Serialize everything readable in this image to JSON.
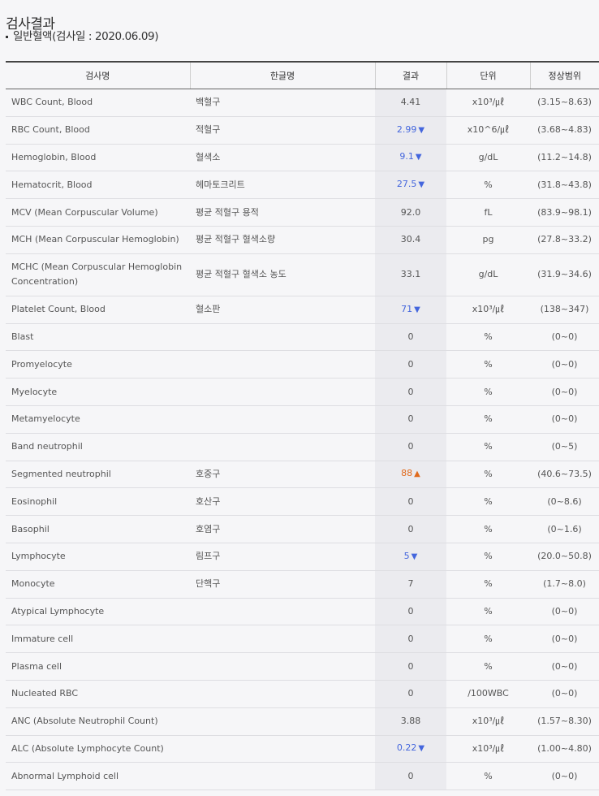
{
  "page_title": "검사결과",
  "subtitle": "일반혈액(검사일 : 2020.06.09)",
  "headers": [
    "검사명",
    "한글명",
    "결과",
    "단위",
    "정상범위"
  ],
  "rows": [
    {
      "name": "WBC Count, Blood",
      "kor": "백혈구",
      "result": "4.41",
      "flag": "",
      "unit": "x10³/㎕",
      "range": "(3.15~8.63)"
    },
    {
      "name": "RBC Count, Blood",
      "kor": "적혈구",
      "result": "2.99",
      "flag": "low",
      "unit": "x10^6/㎕",
      "range": "(3.68~4.83)"
    },
    {
      "name": "Hemoglobin, Blood",
      "kor": "혈색소",
      "result": "9.1",
      "flag": "low",
      "unit": "g/dL",
      "range": "(11.2~14.8)"
    },
    {
      "name": "Hematocrit, Blood",
      "kor": "헤마토크리트",
      "result": "27.5",
      "flag": "low",
      "unit": "%",
      "range": "(31.8~43.8)"
    },
    {
      "name": "MCV (Mean Corpuscular Volume)",
      "kor": "평균 적혈구 용적",
      "result": "92.0",
      "flag": "",
      "unit": "fL",
      "range": "(83.9~98.1)"
    },
    {
      "name": "MCH (Mean Corpuscular Hemoglobin)",
      "kor": "평균 적혈구 혈색소량",
      "result": "30.4",
      "flag": "",
      "unit": "pg",
      "range": "(27.8~33.2)"
    },
    {
      "name": "MCHC (Mean Corpuscular Hemoglobin Concentration)",
      "kor": "평균 적혈구 혈색소 농도",
      "result": "33.1",
      "flag": "",
      "unit": "g/dL",
      "range": "(31.9~34.6)",
      "tall": true
    },
    {
      "name": "Platelet Count, Blood",
      "kor": "혈소판",
      "result": "71",
      "flag": "low",
      "unit": "x10³/㎕",
      "range": "(138~347)"
    },
    {
      "name": "Blast",
      "kor": "",
      "result": "0",
      "flag": "",
      "unit": "%",
      "range": "(0~0)"
    },
    {
      "name": "Promyelocyte",
      "kor": "",
      "result": "0",
      "flag": "",
      "unit": "%",
      "range": "(0~0)"
    },
    {
      "name": "Myelocyte",
      "kor": "",
      "result": "0",
      "flag": "",
      "unit": "%",
      "range": "(0~0)"
    },
    {
      "name": "Metamyelocyte",
      "kor": "",
      "result": "0",
      "flag": "",
      "unit": "%",
      "range": "(0~0)"
    },
    {
      "name": "Band neutrophil",
      "kor": "",
      "result": "0",
      "flag": "",
      "unit": "%",
      "range": "(0~5)"
    },
    {
      "name": "Segmented neutrophil",
      "kor": "호중구",
      "result": "88",
      "flag": "high",
      "unit": "%",
      "range": "(40.6~73.5)"
    },
    {
      "name": "Eosinophil",
      "kor": "호산구",
      "result": "0",
      "flag": "",
      "unit": "%",
      "range": "(0~8.6)"
    },
    {
      "name": "Basophil",
      "kor": "호염구",
      "result": "0",
      "flag": "",
      "unit": "%",
      "range": "(0~1.6)"
    },
    {
      "name": "Lymphocyte",
      "kor": "림프구",
      "result": "5",
      "flag": "low",
      "unit": "%",
      "range": "(20.0~50.8)"
    },
    {
      "name": "Monocyte",
      "kor": "단핵구",
      "result": "7",
      "flag": "",
      "unit": "%",
      "range": "(1.7~8.0)"
    },
    {
      "name": "Atypical Lymphocyte",
      "kor": "",
      "result": "0",
      "flag": "",
      "unit": "%",
      "range": "(0~0)"
    },
    {
      "name": "Immature cell",
      "kor": "",
      "result": "0",
      "flag": "",
      "unit": "%",
      "range": "(0~0)"
    },
    {
      "name": "Plasma cell",
      "kor": "",
      "result": "0",
      "flag": "",
      "unit": "%",
      "range": "(0~0)"
    },
    {
      "name": "Nucleated RBC",
      "kor": "",
      "result": "0",
      "flag": "",
      "unit": "/100WBC",
      "range": "(0~0)"
    },
    {
      "name": "ANC (Absolute Neutrophil Count)",
      "kor": "",
      "result": "3.88",
      "flag": "",
      "unit": "x10³/㎕",
      "range": "(1.57~8.30)"
    },
    {
      "name": "ALC (Absolute Lymphocyte Count)",
      "kor": "",
      "result": "0.22",
      "flag": "low",
      "unit": "x10³/㎕",
      "range": "(1.00~4.80)"
    },
    {
      "name": "Abnormal Lymphoid cell",
      "kor": "",
      "result": "0",
      "flag": "",
      "unit": "%",
      "range": "(0~0)"
    }
  ],
  "flag_icons": {
    "low": "down-triangle-icon",
    "high": "up-triangle-icon"
  },
  "colors": {
    "low": "#4466dd",
    "high": "#e06a1c",
    "result_column_bg": "#ebebef"
  }
}
